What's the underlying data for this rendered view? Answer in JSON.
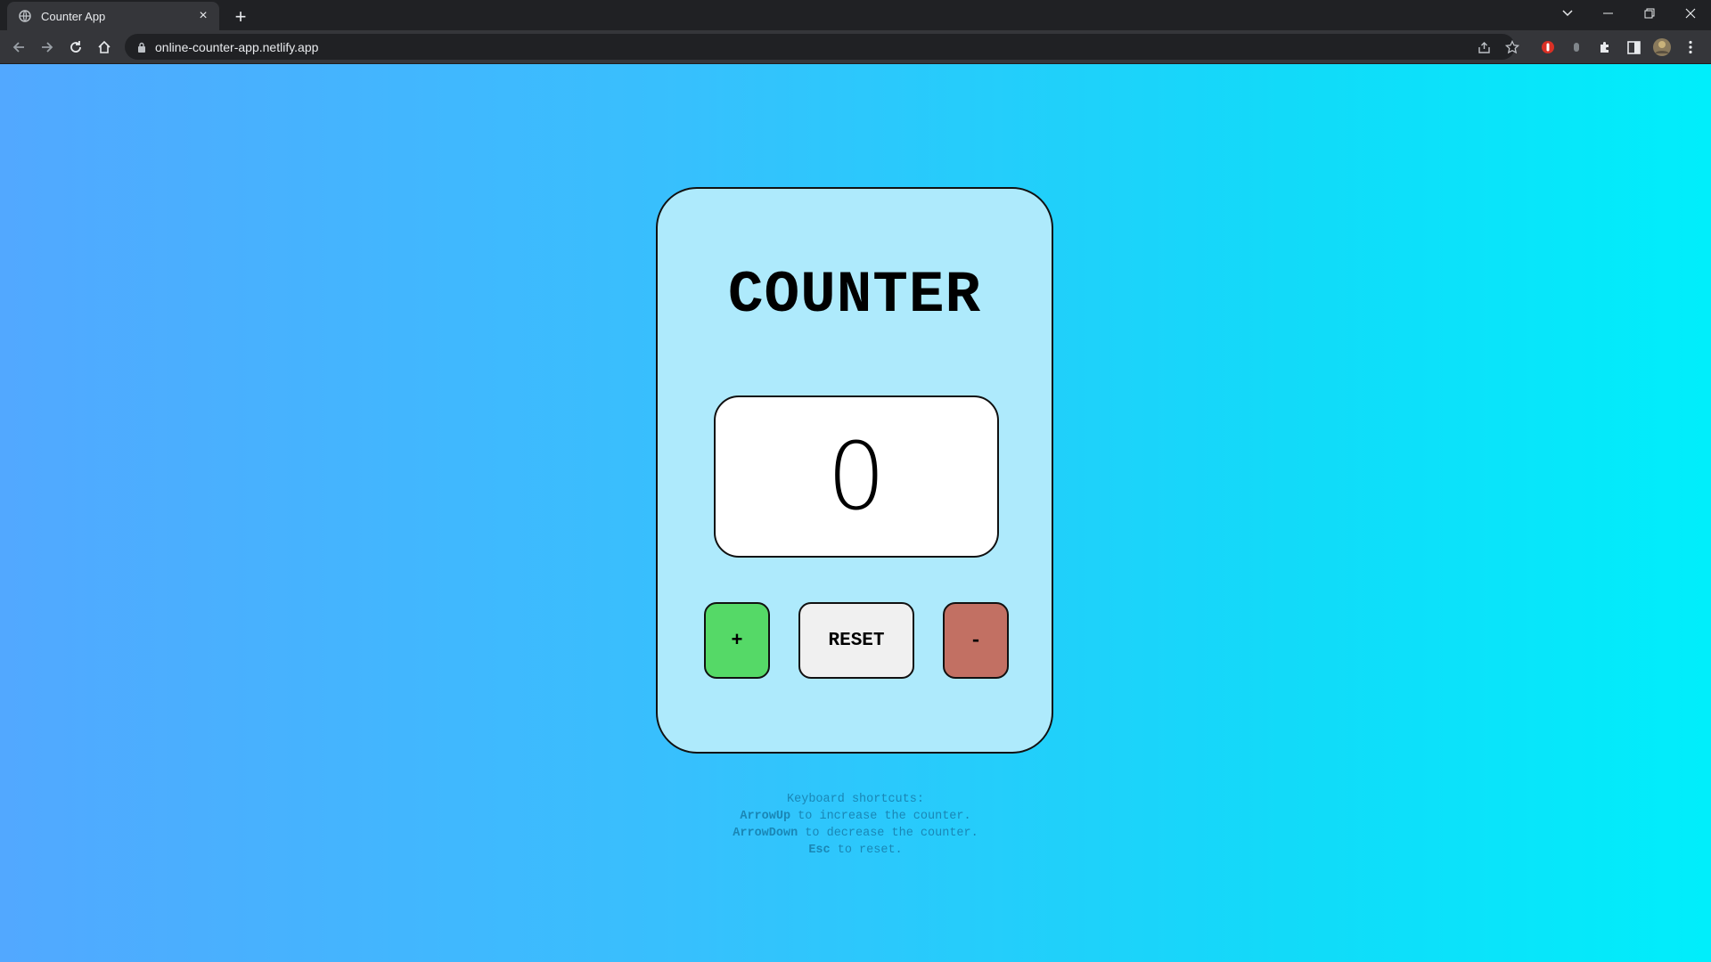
{
  "browser": {
    "tab": {
      "title": "Counter App",
      "close": "×"
    },
    "new_tab": "+",
    "url": "online-counter-app.netlify.app"
  },
  "app": {
    "title": "COUNTER",
    "count": "0",
    "buttons": {
      "increment": "+",
      "reset": "RESET",
      "decrement": "-"
    },
    "colors": {
      "card_bg": "#aeeafc",
      "increment_bg": "#55d967",
      "reset_bg": "#f0f0f0",
      "decrement_bg": "#c27063"
    }
  },
  "shortcuts": {
    "heading": "Keyboard shortcuts:",
    "lines": [
      {
        "key": "ArrowUp",
        "text": " to increase the counter."
      },
      {
        "key": "ArrowDown",
        "text": " to decrease the counter."
      },
      {
        "key": "Esc",
        "text": " to reset."
      }
    ]
  },
  "icons": [
    "globe-icon",
    "close-icon",
    "plus-icon",
    "chevron-down-icon",
    "minimize-icon",
    "restore-icon",
    "window-close-icon",
    "back-icon",
    "forward-icon",
    "reload-icon",
    "home-icon",
    "lock-icon",
    "share-icon",
    "star-icon",
    "extension-red-icon",
    "extension-gray-icon",
    "puzzle-icon",
    "side-panel-icon",
    "profile-avatar-icon",
    "menu-icon"
  ]
}
